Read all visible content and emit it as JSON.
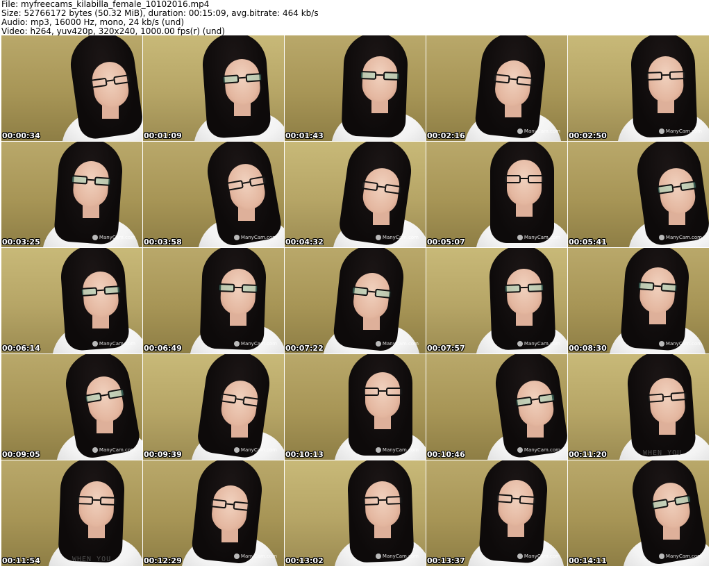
{
  "header": {
    "file_line": "File: myfreecams_kilabilla_female_10102016.mp4",
    "size_line": "Size: 52766172 bytes (50.32 MiB), duration: 00:15:09, avg.bitrate: 464 kb/s",
    "audio_line": "Audio: mp3, 16000 Hz, mono, 24 kb/s (und)",
    "video_line": "Video: h264, yuv420p, 320x240, 1000.00 fps(r) (und)"
  },
  "watermark_text": "ManyCam.com",
  "shirt_text": "WHEN YOU",
  "thumbnails": [
    {
      "time": "00:00:34",
      "logo": false,
      "glasses_tint": false,
      "shirt_text": false
    },
    {
      "time": "00:01:09",
      "logo": false,
      "glasses_tint": true,
      "shirt_text": false
    },
    {
      "time": "00:01:43",
      "logo": false,
      "glasses_tint": true,
      "shirt_text": false
    },
    {
      "time": "00:02:16",
      "logo": true,
      "glasses_tint": false,
      "shirt_text": false
    },
    {
      "time": "00:02:50",
      "logo": true,
      "glasses_tint": false,
      "shirt_text": false
    },
    {
      "time": "00:03:25",
      "logo": true,
      "glasses_tint": true,
      "shirt_text": false
    },
    {
      "time": "00:03:58",
      "logo": true,
      "glasses_tint": false,
      "shirt_text": false
    },
    {
      "time": "00:04:32",
      "logo": true,
      "glasses_tint": false,
      "shirt_text": false
    },
    {
      "time": "00:05:07",
      "logo": true,
      "glasses_tint": false,
      "shirt_text": false
    },
    {
      "time": "00:05:41",
      "logo": true,
      "glasses_tint": true,
      "shirt_text": false
    },
    {
      "time": "00:06:14",
      "logo": true,
      "glasses_tint": true,
      "shirt_text": false
    },
    {
      "time": "00:06:49",
      "logo": true,
      "glasses_tint": true,
      "shirt_text": false
    },
    {
      "time": "00:07:22",
      "logo": true,
      "glasses_tint": true,
      "shirt_text": false
    },
    {
      "time": "00:07:57",
      "logo": true,
      "glasses_tint": true,
      "shirt_text": false
    },
    {
      "time": "00:08:30",
      "logo": true,
      "glasses_tint": true,
      "shirt_text": false
    },
    {
      "time": "00:09:05",
      "logo": true,
      "glasses_tint": true,
      "shirt_text": false
    },
    {
      "time": "00:09:39",
      "logo": true,
      "glasses_tint": false,
      "shirt_text": false
    },
    {
      "time": "00:10:13",
      "logo": true,
      "glasses_tint": false,
      "shirt_text": false
    },
    {
      "time": "00:10:46",
      "logo": true,
      "glasses_tint": true,
      "shirt_text": false
    },
    {
      "time": "00:11:20",
      "logo": false,
      "glasses_tint": false,
      "shirt_text": true
    },
    {
      "time": "00:11:54",
      "logo": false,
      "glasses_tint": false,
      "shirt_text": true
    },
    {
      "time": "00:12:29",
      "logo": true,
      "glasses_tint": false,
      "shirt_text": false
    },
    {
      "time": "00:13:02",
      "logo": true,
      "glasses_tint": false,
      "shirt_text": false
    },
    {
      "time": "00:13:37",
      "logo": true,
      "glasses_tint": false,
      "shirt_text": false
    },
    {
      "time": "00:14:11",
      "logo": true,
      "glasses_tint": true,
      "shirt_text": false
    }
  ]
}
